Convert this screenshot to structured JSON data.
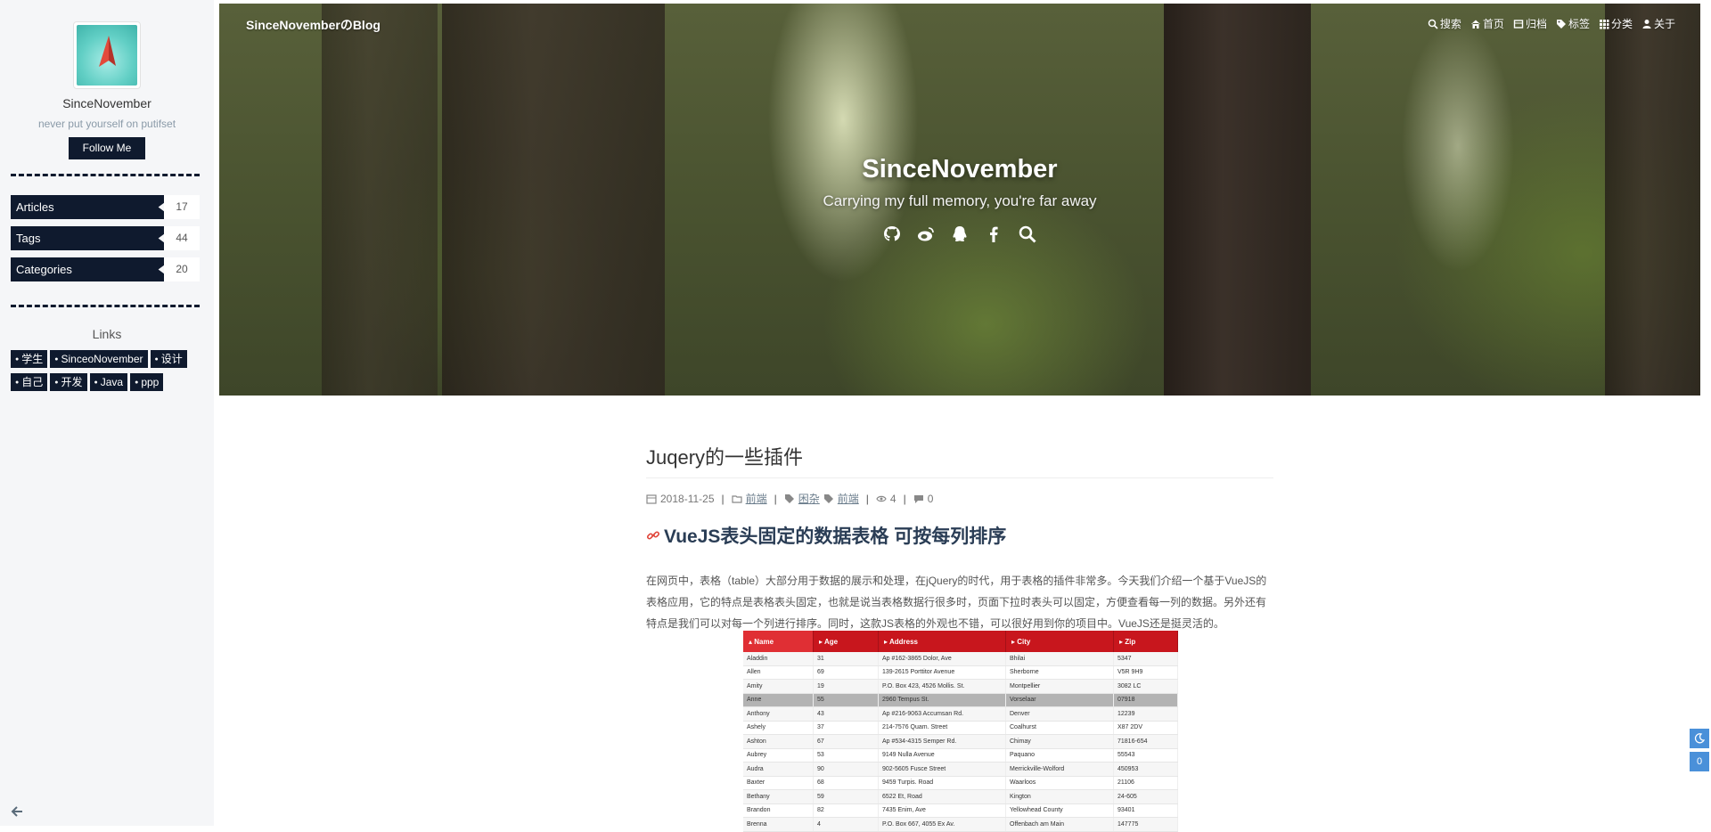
{
  "sidebar": {
    "author": "SinceNovember",
    "description": "never put yourself on putifset",
    "follow_label": "Follow Me",
    "stats": [
      {
        "label": "Articles",
        "count": "17"
      },
      {
        "label": "Tags",
        "count": "44"
      },
      {
        "label": "Categories",
        "count": "20"
      }
    ],
    "links_title": "Links",
    "links": [
      "学生",
      "SinceoNovember",
      "设计",
      "自己",
      "开发",
      "Java",
      "ppp"
    ]
  },
  "header": {
    "brand": "SinceNovemberのBlog",
    "nav": [
      {
        "label": "搜索",
        "icon": "search-icon"
      },
      {
        "label": "首页",
        "icon": "home-icon"
      },
      {
        "label": "归档",
        "icon": "archive-icon"
      },
      {
        "label": "标签",
        "icon": "tags-icon"
      },
      {
        "label": "分类",
        "icon": "grid-icon"
      },
      {
        "label": "关于",
        "icon": "user-icon"
      }
    ],
    "title": "SinceNovember",
    "subtitle": "Carrying my full memory, you're far away",
    "social_icons": [
      "github-icon",
      "weibo-icon",
      "qq-icon",
      "facebook-icon",
      "search-icon"
    ]
  },
  "post": {
    "title": "Juqery的一些插件",
    "date": "2018-11-25",
    "category": "前端",
    "tags": [
      "困杂",
      "前端"
    ],
    "views": "4",
    "comments": "0",
    "heading": "VueJS表头固定的数据表格 可按每列排序",
    "paragraph": "在网页中，表格（table）大部分用于数据的展示和处理，在jQuery的时代，用于表格的插件非常多。今天我们介绍一个基于VueJS的表格应用，它的特点是表格表头固定，也就是说当表格数据行很多时，页面下拉时表头可以固定，方便查看每一列的数据。另外还有特点是我们可以对每一个列进行排序。同时，这款JS表格的外观也不错，可以很好用到你的项目中。VueJS还是挺灵活的。"
  },
  "demo_table": {
    "headers": [
      "Name",
      "Age",
      "Address",
      "City",
      "Zip"
    ],
    "rows": [
      [
        "Aladdin",
        "31",
        "Ap #162-3865 Dolor, Ave",
        "Bhilai",
        "5347"
      ],
      [
        "Allen",
        "69",
        "139-2615 Porttitor Avenue",
        "Sherborne",
        "V5R 9H9"
      ],
      [
        "Amity",
        "19",
        "P.O. Box 423, 4526 Mollis. St.",
        "Montpellier",
        "3082 LC"
      ],
      [
        "Anne",
        "55",
        "2960 Tempus St.",
        "Vorselaar",
        "07918"
      ],
      [
        "Anthony",
        "43",
        "Ap #216-9063 Accumsan Rd.",
        "Denver",
        "12239"
      ],
      [
        "Ashely",
        "37",
        "214-7576 Quam. Street",
        "Coalhurst",
        "X87 2DV"
      ],
      [
        "Ashton",
        "67",
        "Ap #534-4315 Semper Rd.",
        "Chimay",
        "71816-654"
      ],
      [
        "Aubrey",
        "53",
        "9149 Nulla Avenue",
        "Paquano",
        "55543"
      ],
      [
        "Audra",
        "90",
        "902-5605 Fusce Street",
        "Merrickville-Wolford",
        "450953"
      ],
      [
        "Baxter",
        "68",
        "9459 Turpis. Road",
        "Waarloos",
        "21106"
      ],
      [
        "Bethany",
        "59",
        "6522 Et, Road",
        "Kington",
        "24-605"
      ],
      [
        "Brandon",
        "82",
        "7435 Enim, Ave",
        "Yellowhead County",
        "93401"
      ],
      [
        "Brenna",
        "4",
        "P.O. Box 667, 4055 Ex Av.",
        "Offenbach am Main",
        "147775"
      ]
    ]
  },
  "float": {
    "count": "0"
  }
}
